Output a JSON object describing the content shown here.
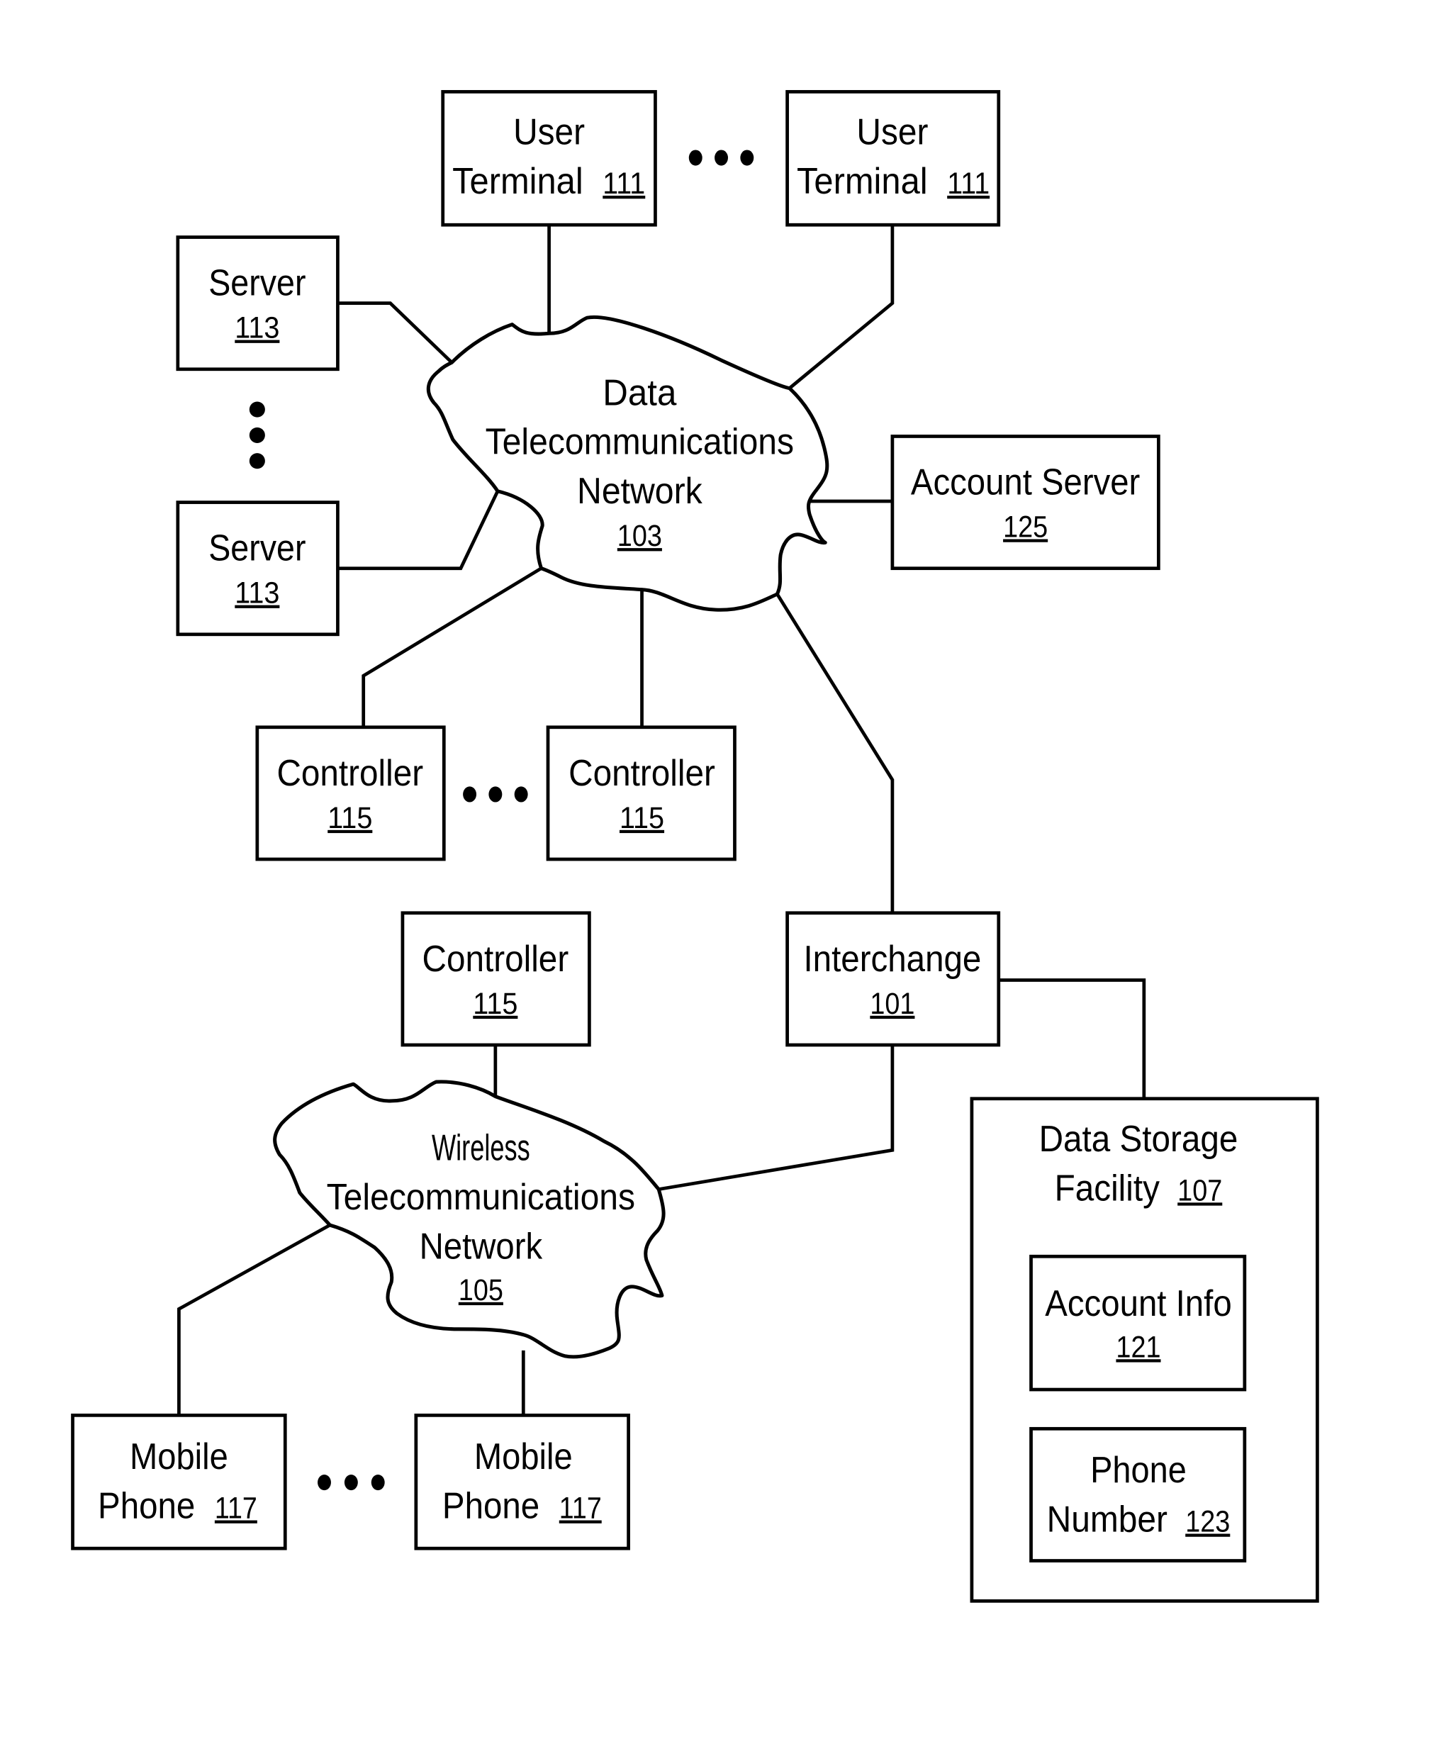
{
  "diagram": {
    "type": "network block diagram",
    "colors": {
      "line": "#000000",
      "background": "#ffffff"
    },
    "nodes": {
      "user_terminal_1": {
        "lines": [
          "User",
          "Terminal"
        ],
        "ref": "111"
      },
      "user_terminal_2": {
        "lines": [
          "User",
          "Terminal"
        ],
        "ref": "111"
      },
      "server_1": {
        "lines": [
          "Server"
        ],
        "ref": "113"
      },
      "server_2": {
        "lines": [
          "Server"
        ],
        "ref": "113"
      },
      "data_network": {
        "lines": [
          "Data",
          "Telecommunications",
          "Network"
        ],
        "ref": "103"
      },
      "account_server": {
        "lines": [
          "Account Server"
        ],
        "ref": "125"
      },
      "controller_1": {
        "lines": [
          "Controller"
        ],
        "ref": "115"
      },
      "controller_2": {
        "lines": [
          "Controller"
        ],
        "ref": "115"
      },
      "controller_3": {
        "lines": [
          "Controller"
        ],
        "ref": "115"
      },
      "interchange": {
        "lines": [
          "Interchange"
        ],
        "ref": "101"
      },
      "wireless_network": {
        "lines": [
          "Wireless",
          "Telecommunications",
          "Network"
        ],
        "ref": "105"
      },
      "data_storage": {
        "lines": [
          "Data Storage",
          "Facility"
        ],
        "ref": "107"
      },
      "account_info": {
        "lines": [
          "Account Info"
        ],
        "ref": "121"
      },
      "phone_number": {
        "lines": [
          "Phone",
          "Number"
        ],
        "ref": "123"
      },
      "mobile_phone_1": {
        "lines": [
          "Mobile",
          "Phone"
        ],
        "ref": "117"
      },
      "mobile_phone_2": {
        "lines": [
          "Mobile",
          "Phone"
        ],
        "ref": "117"
      }
    },
    "ellipses": [
      {
        "between": [
          "user_terminal_1",
          "user_terminal_2"
        ],
        "orientation": "horizontal"
      },
      {
        "between": [
          "server_1",
          "server_2"
        ],
        "orientation": "vertical"
      },
      {
        "between": [
          "controller_1",
          "controller_2"
        ],
        "orientation": "horizontal"
      },
      {
        "between": [
          "mobile_phone_1",
          "mobile_phone_2"
        ],
        "orientation": "horizontal"
      }
    ],
    "edges": [
      [
        "user_terminal_1",
        "data_network"
      ],
      [
        "user_terminal_2",
        "data_network"
      ],
      [
        "server_1",
        "data_network"
      ],
      [
        "server_2",
        "data_network"
      ],
      [
        "account_server",
        "data_network"
      ],
      [
        "controller_1",
        "data_network"
      ],
      [
        "controller_2",
        "data_network"
      ],
      [
        "interchange",
        "data_network"
      ],
      [
        "interchange",
        "wireless_network"
      ],
      [
        "interchange",
        "data_storage"
      ],
      [
        "controller_3",
        "wireless_network"
      ],
      [
        "mobile_phone_1",
        "wireless_network"
      ],
      [
        "mobile_phone_2",
        "wireless_network"
      ],
      [
        "account_info",
        "phone_number"
      ]
    ]
  }
}
